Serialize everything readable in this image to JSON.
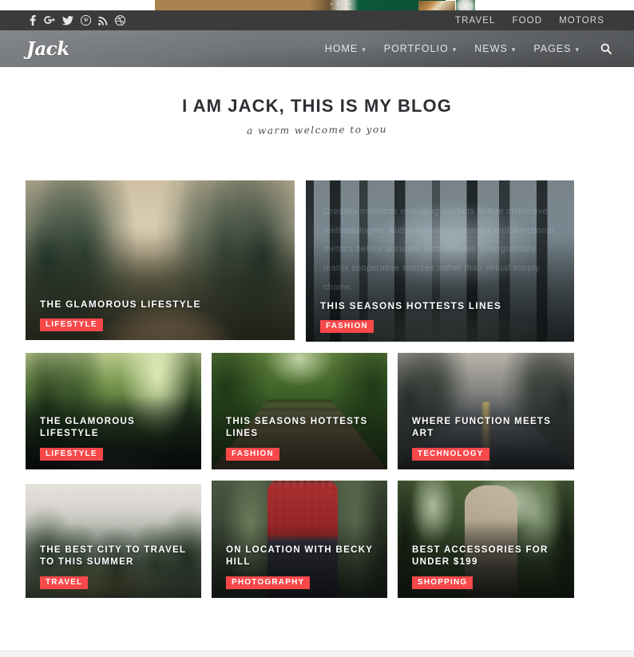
{
  "topbar": {
    "social_icons": [
      {
        "name": "facebook-icon",
        "label": "Facebook"
      },
      {
        "name": "google-plus-icon",
        "label": "Google Plus"
      },
      {
        "name": "twitter-icon",
        "label": "Twitter"
      },
      {
        "name": "pinterest-icon",
        "label": "Pinterest"
      },
      {
        "name": "rss-icon",
        "label": "RSS"
      },
      {
        "name": "dribbble-icon",
        "label": "Dribbble"
      }
    ],
    "links": [
      {
        "label": "TRAVEL"
      },
      {
        "label": "FOOD"
      },
      {
        "label": "MOTORS"
      }
    ]
  },
  "navbar": {
    "logo": "Jack",
    "items": [
      {
        "label": "HOME",
        "caret": "▾"
      },
      {
        "label": "PORTFOLIO",
        "caret": "▾"
      },
      {
        "label": "NEWS",
        "caret": "▾"
      },
      {
        "label": "PAGES",
        "caret": "▾"
      }
    ],
    "search_icon": "⚲"
  },
  "heading": {
    "title": "I AM JACK, THIS IS MY BLOG",
    "subtitle": "a warm welcome to you"
  },
  "colors": {
    "tag_red": "#f8484a",
    "topbar_bg": "#3b3b3c",
    "navbar_bg": "#6e7174",
    "title_color": "#2c2f33"
  },
  "bleed_text": "Credibly monetize emerging markets before distinctive methodologies. Authoritatively customize multifunctional metrics before accurate technologies. Energistically matrix cooperative sources rather than virtual supply chains.",
  "grid": {
    "rows": [
      {
        "cards": [
          {
            "title": "THE GLAMOROUS LIFESTYLE",
            "tag": "LIFESTYLE",
            "photo": "forest-road"
          },
          {
            "title": "THIS SEASONS HOTTESTS LINES",
            "tag": "FASHION",
            "photo": "misty-forest"
          }
        ]
      },
      {
        "cards": [
          {
            "title": "THE GLAMOROUS LIFESTYLE",
            "tag": "LIFESTYLE",
            "photo": "sunlit-forest-path"
          },
          {
            "title": "THIS SEASONS HOTTESTS LINES",
            "tag": "FASHION",
            "photo": "railroad-tracks"
          },
          {
            "title": "WHERE FUNCTION MEETS ART",
            "tag": "TECHNOLOGY",
            "photo": "wet-road"
          }
        ]
      },
      {
        "cards": [
          {
            "title": "THE BEST CITY TO TRAVEL TO THIS SUMMER",
            "tag": "TRAVEL",
            "photo": "foggy-pines"
          },
          {
            "title": "ON LOCATION WITH BECKY HILL",
            "tag": "PHOTOGRAPHY",
            "photo": "woman-plaid"
          },
          {
            "title": "BEST ACCESSORIES FOR UNDER $199",
            "tag": "SHOPPING",
            "photo": "hiker-backpack"
          }
        ]
      }
    ]
  }
}
